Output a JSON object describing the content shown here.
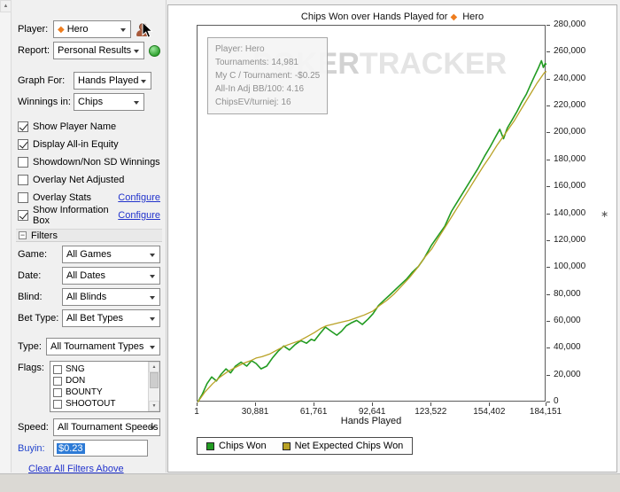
{
  "sidebar": {
    "player_label": "Player:",
    "player_value": "Hero",
    "report_label": "Report:",
    "report_value": "Personal Results",
    "graph_for_label": "Graph For:",
    "graph_for_value": "Hands Played",
    "winnings_label": "Winnings in:",
    "winnings_value": "Chips",
    "checkboxes": [
      {
        "label": "Show Player Name",
        "checked": true
      },
      {
        "label": "Display All-in Equity",
        "checked": true
      },
      {
        "label": "Showdown/Non SD Winnings",
        "checked": false
      },
      {
        "label": "Overlay Net Adjusted",
        "checked": false
      },
      {
        "label": "Overlay Stats",
        "checked": false,
        "link": "Configure"
      },
      {
        "label": "Show Information Box",
        "checked": true,
        "link": "Configure"
      }
    ],
    "filters_header": "Filters",
    "filter_rows": [
      {
        "label": "Game:",
        "value": "All Games"
      },
      {
        "label": "Date:",
        "value": "All Dates"
      },
      {
        "label": "Blind:",
        "value": "All Blinds"
      },
      {
        "label": "Bet Type:",
        "value": "All Bet Types"
      }
    ],
    "type_label": "Type:",
    "type_value": "All Tournament Types",
    "flags_label": "Flags:",
    "flags_items": [
      {
        "label": "SNG",
        "checked": false
      },
      {
        "label": "DON",
        "checked": false
      },
      {
        "label": "BOUNTY",
        "checked": false
      },
      {
        "label": "SHOOTOUT",
        "checked": false
      }
    ],
    "speed_label": "Speed:",
    "speed_value": "All Tournament Speeds",
    "buyin_label": "Buyin:",
    "buyin_value": "$0.23",
    "clear_link": "Clear All Filters Above"
  },
  "chart_panel": {
    "title_prefix": "Chips Won over Hands Played for",
    "title_player": "Hero"
  },
  "chart_data": {
    "type": "line",
    "title": "Chips Won over Hands Played for ◆ Hero",
    "xlabel": "Hands Played",
    "ylabel": "",
    "xlim": [
      1,
      184151
    ],
    "ylim": [
      0,
      280000
    ],
    "grid": false,
    "y_axis_side": "right",
    "legend_position": "bottom-left",
    "watermark": {
      "part1": "POKER",
      "part2": "TRACKER"
    },
    "info_box": [
      "Player: Hero",
      "Tournaments: 14,981",
      "My C / Tournament: -$0.25",
      "All-In Adj BB/100: 4.16",
      "ChipsEV/turniej: 16"
    ],
    "x_ticks": [
      {
        "value": 1,
        "label": "1"
      },
      {
        "value": 30881,
        "label": "30,881"
      },
      {
        "value": 61761,
        "label": "61,761"
      },
      {
        "value": 92641,
        "label": "92,641"
      },
      {
        "value": 123522,
        "label": "123,522"
      },
      {
        "value": 154402,
        "label": "154,402"
      },
      {
        "value": 184151,
        "label": "184,151"
      }
    ],
    "y_ticks": [
      {
        "value": 0,
        "label": "0"
      },
      {
        "value": 20000,
        "label": "20,000"
      },
      {
        "value": 40000,
        "label": "40,000"
      },
      {
        "value": 60000,
        "label": "60,000"
      },
      {
        "value": 80000,
        "label": "80,000"
      },
      {
        "value": 100000,
        "label": "100,000"
      },
      {
        "value": 120000,
        "label": "120,000"
      },
      {
        "value": 140000,
        "label": "140,000"
      },
      {
        "value": 160000,
        "label": "160,000"
      },
      {
        "value": 180000,
        "label": "180,000"
      },
      {
        "value": 200000,
        "label": "200,000"
      },
      {
        "value": 220000,
        "label": "220,000"
      },
      {
        "value": 240000,
        "label": "240,000"
      },
      {
        "value": 260000,
        "label": "260,000"
      },
      {
        "value": 280000,
        "label": "280,000"
      }
    ],
    "series": [
      {
        "name": "Chips Won",
        "color": "#219b21",
        "width": 1.6,
        "points": [
          [
            1,
            0
          ],
          [
            2500,
            6000
          ],
          [
            5000,
            14000
          ],
          [
            7500,
            19000
          ],
          [
            10000,
            16000
          ],
          [
            12500,
            21000
          ],
          [
            15000,
            25000
          ],
          [
            17500,
            22000
          ],
          [
            20000,
            27000
          ],
          [
            23000,
            30000
          ],
          [
            26000,
            27000
          ],
          [
            28500,
            31000
          ],
          [
            30881,
            29000
          ],
          [
            33500,
            25000
          ],
          [
            36500,
            27000
          ],
          [
            39500,
            33000
          ],
          [
            42500,
            38000
          ],
          [
            45500,
            42000
          ],
          [
            48500,
            39000
          ],
          [
            51500,
            43000
          ],
          [
            54500,
            46000
          ],
          [
            57500,
            44000
          ],
          [
            60000,
            47000
          ],
          [
            61761,
            46000
          ],
          [
            64500,
            51000
          ],
          [
            67500,
            56000
          ],
          [
            70500,
            53000
          ],
          [
            73500,
            50000
          ],
          [
            76000,
            53000
          ],
          [
            78500,
            57000
          ],
          [
            81000,
            59000
          ],
          [
            84000,
            61000
          ],
          [
            87000,
            58000
          ],
          [
            90000,
            62000
          ],
          [
            92641,
            66000
          ],
          [
            95500,
            72000
          ],
          [
            98500,
            76000
          ],
          [
            101500,
            80000
          ],
          [
            104500,
            84000
          ],
          [
            107500,
            88000
          ],
          [
            110500,
            92000
          ],
          [
            113500,
            97000
          ],
          [
            116500,
            101000
          ],
          [
            119500,
            107000
          ],
          [
            123522,
            117000
          ],
          [
            127000,
            124000
          ],
          [
            130500,
            131000
          ],
          [
            134000,
            142000
          ],
          [
            137500,
            150000
          ],
          [
            141000,
            158000
          ],
          [
            144500,
            166000
          ],
          [
            148000,
            174000
          ],
          [
            151500,
            183000
          ],
          [
            154402,
            190000
          ],
          [
            157500,
            198000
          ],
          [
            159500,
            203000
          ],
          [
            161500,
            196000
          ],
          [
            163500,
            204000
          ],
          [
            166000,
            210000
          ],
          [
            168500,
            216000
          ],
          [
            171000,
            223000
          ],
          [
            173500,
            229000
          ],
          [
            176000,
            237000
          ],
          [
            178000,
            243000
          ],
          [
            180000,
            249000
          ],
          [
            181500,
            254000
          ],
          [
            182500,
            249000
          ],
          [
            183500,
            252000
          ],
          [
            184151,
            251000
          ]
        ]
      },
      {
        "name": "Net Expected Chips Won",
        "color": "#b9a226",
        "width": 1.3,
        "points": [
          [
            1,
            0
          ],
          [
            4000,
            8000
          ],
          [
            8000,
            14000
          ],
          [
            12000,
            19000
          ],
          [
            16000,
            23000
          ],
          [
            20000,
            26000
          ],
          [
            24000,
            29000
          ],
          [
            28000,
            31000
          ],
          [
            30881,
            33000
          ],
          [
            34000,
            34000
          ],
          [
            38000,
            36000
          ],
          [
            42000,
            39000
          ],
          [
            46000,
            42000
          ],
          [
            50000,
            44000
          ],
          [
            54000,
            46000
          ],
          [
            58000,
            49000
          ],
          [
            61761,
            52000
          ],
          [
            65000,
            55000
          ],
          [
            68000,
            57000
          ],
          [
            71000,
            58000
          ],
          [
            74000,
            59000
          ],
          [
            77000,
            60000
          ],
          [
            80000,
            61000
          ],
          [
            84000,
            63000
          ],
          [
            88000,
            65000
          ],
          [
            92641,
            68000
          ],
          [
            96000,
            72000
          ],
          [
            100000,
            76000
          ],
          [
            104000,
            81000
          ],
          [
            108000,
            87000
          ],
          [
            112000,
            93000
          ],
          [
            116000,
            100000
          ],
          [
            120000,
            108000
          ],
          [
            123522,
            114000
          ],
          [
            127000,
            122000
          ],
          [
            131000,
            131000
          ],
          [
            135000,
            140000
          ],
          [
            139000,
            149000
          ],
          [
            143000,
            158000
          ],
          [
            147000,
            167000
          ],
          [
            151000,
            176000
          ],
          [
            154402,
            183000
          ],
          [
            158000,
            191000
          ],
          [
            161000,
            197000
          ],
          [
            164000,
            203000
          ],
          [
            167000,
            209000
          ],
          [
            170000,
            216000
          ],
          [
            173000,
            223000
          ],
          [
            176000,
            230000
          ],
          [
            179000,
            237000
          ],
          [
            181500,
            242000
          ],
          [
            183000,
            245000
          ],
          [
            184151,
            246000
          ]
        ]
      }
    ]
  }
}
